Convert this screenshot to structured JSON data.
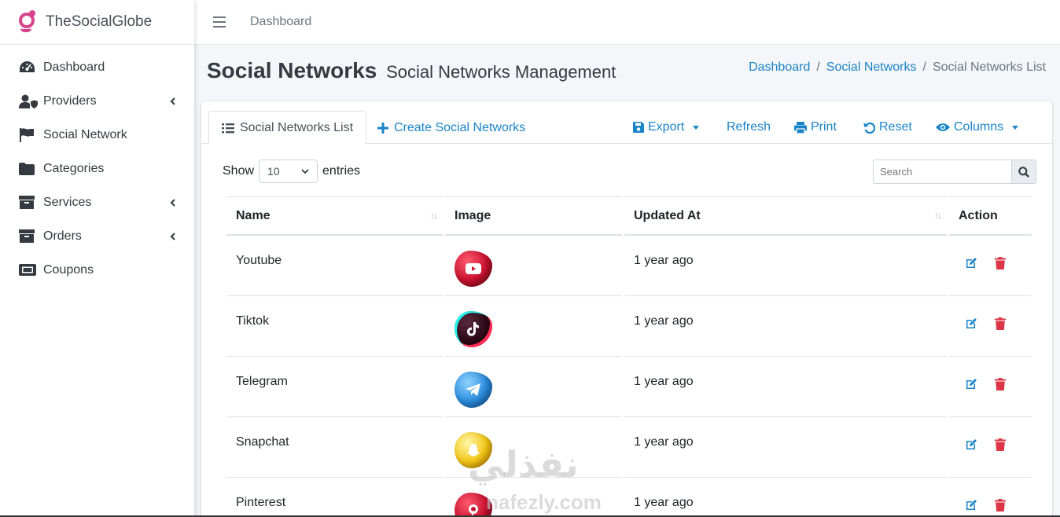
{
  "brand": {
    "name": "TheSocialGlobe",
    "accent": "#d6448b"
  },
  "sidebar": {
    "items": [
      {
        "label": "Dashboard",
        "icon": "tachometer-icon",
        "expandable": false
      },
      {
        "label": "Providers",
        "icon": "user-shield-icon",
        "expandable": true
      },
      {
        "label": "Social Network",
        "icon": "flag-icon",
        "expandable": false
      },
      {
        "label": "Categories",
        "icon": "folder-icon",
        "expandable": false
      },
      {
        "label": "Services",
        "icon": "archive-icon",
        "expandable": true
      },
      {
        "label": "Orders",
        "icon": "archive-icon",
        "expandable": true
      },
      {
        "label": "Coupons",
        "icon": "ticket-icon",
        "expandable": false
      }
    ]
  },
  "topbar": {
    "link": "Dashboard"
  },
  "header": {
    "title": "Social Networks",
    "subtitle": "Social Networks Management",
    "breadcrumb": [
      "Dashboard",
      "Social Networks",
      "Social Networks List"
    ]
  },
  "tabs": {
    "list": "Social Networks List",
    "create": "Create Social Networks"
  },
  "toolbar": {
    "export": "Export",
    "refresh": "Refresh",
    "print": "Print",
    "reset": "Reset",
    "columns": "Columns"
  },
  "table_controls": {
    "show": "Show",
    "entries": "entries",
    "page_size": "10",
    "search_placeholder": "Search"
  },
  "table": {
    "headers": [
      "Name",
      "Image",
      "Updated At",
      "Action"
    ],
    "rows": [
      {
        "name": "Youtube",
        "updated": "1 year ago",
        "color": "#c8102e",
        "icon": "youtube-icon"
      },
      {
        "name": "Tiktok",
        "updated": "1 year ago",
        "color": "#3a0b1e",
        "icon": "tiktok-icon"
      },
      {
        "name": "Telegram",
        "updated": "1 year ago",
        "color": "#2a8bdc",
        "icon": "telegram-icon"
      },
      {
        "name": "Snapchat",
        "updated": "1 year ago",
        "color": "#f3c613",
        "icon": "snapchat-icon"
      },
      {
        "name": "Pinterest",
        "updated": "1 year ago",
        "color": "#c8102e",
        "icon": "pinterest-icon"
      }
    ]
  },
  "colors": {
    "link": "#1a84c7",
    "edit": "#1a84c7",
    "delete": "#dc3545"
  },
  "watermark": {
    "arabic": "نفذلي",
    "latin": "nafezly.com"
  }
}
